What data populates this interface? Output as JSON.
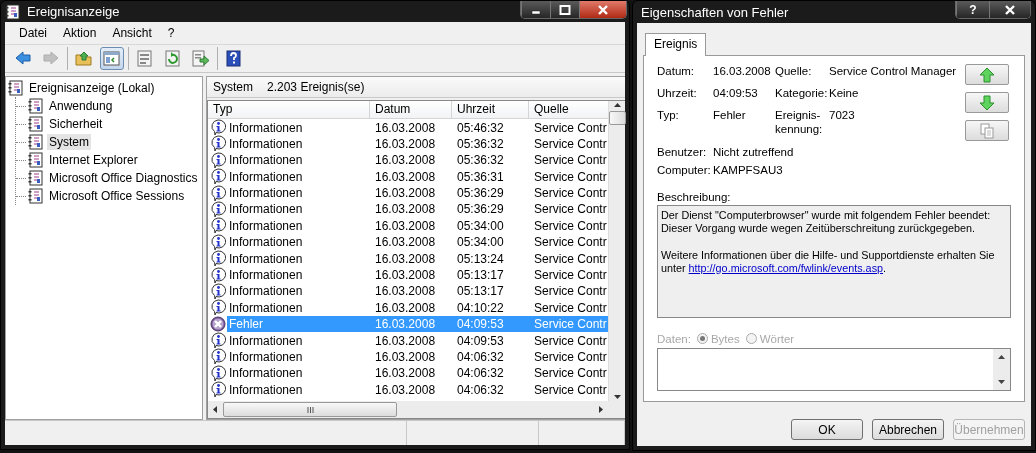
{
  "main_window": {
    "title": "Ereignisanzeige",
    "menu": [
      "Datei",
      "Aktion",
      "Ansicht",
      "?"
    ],
    "toolbar": [
      [
        {
          "kind": "back",
          "disabled": false,
          "pressed": false
        },
        {
          "kind": "forward",
          "disabled": true,
          "pressed": false
        }
      ],
      [
        {
          "kind": "up",
          "disabled": false,
          "pressed": false
        },
        {
          "kind": "tree",
          "disabled": false,
          "pressed": true
        }
      ],
      [
        {
          "kind": "properties",
          "disabled": false,
          "pressed": false
        },
        {
          "kind": "refresh",
          "disabled": false,
          "pressed": false
        },
        {
          "kind": "export",
          "disabled": false,
          "pressed": false
        }
      ],
      [
        {
          "kind": "help",
          "disabled": false,
          "pressed": false
        }
      ]
    ],
    "tree": {
      "label": "Ereignisanzeige (Lokal)",
      "children": [
        {
          "label": "Anwendung",
          "selected": false
        },
        {
          "label": "Sicherheit",
          "selected": false
        },
        {
          "label": "System",
          "selected": true
        },
        {
          "label": "Internet Explorer",
          "selected": false
        },
        {
          "label": "Microsoft Office Diagnostics",
          "selected": false
        },
        {
          "label": "Microsoft Office Sessions",
          "selected": false
        }
      ]
    },
    "pane": {
      "log": "System",
      "count": "2.203 Ereignis(se)"
    },
    "table": {
      "columns": [
        "Typ",
        "Datum",
        "Uhrzeit",
        "Quelle"
      ],
      "rows": [
        {
          "kind": "info",
          "type": "Informationen",
          "date": "16.03.2008",
          "time": "05:46:32",
          "source": "Service Contr",
          "selected": false
        },
        {
          "kind": "info",
          "type": "Informationen",
          "date": "16.03.2008",
          "time": "05:36:32",
          "source": "Service Contr",
          "selected": false
        },
        {
          "kind": "info",
          "type": "Informationen",
          "date": "16.03.2008",
          "time": "05:36:32",
          "source": "Service Contr",
          "selected": false
        },
        {
          "kind": "info",
          "type": "Informationen",
          "date": "16.03.2008",
          "time": "05:36:31",
          "source": "Service Contr",
          "selected": false
        },
        {
          "kind": "info",
          "type": "Informationen",
          "date": "16.03.2008",
          "time": "05:36:29",
          "source": "Service Contr",
          "selected": false
        },
        {
          "kind": "info",
          "type": "Informationen",
          "date": "16.03.2008",
          "time": "05:36:29",
          "source": "Service Contr",
          "selected": false
        },
        {
          "kind": "info",
          "type": "Informationen",
          "date": "16.03.2008",
          "time": "05:34:00",
          "source": "Service Contr",
          "selected": false
        },
        {
          "kind": "info",
          "type": "Informationen",
          "date": "16.03.2008",
          "time": "05:34:00",
          "source": "Service Contr",
          "selected": false
        },
        {
          "kind": "info",
          "type": "Informationen",
          "date": "16.03.2008",
          "time": "05:13:24",
          "source": "Service Contr",
          "selected": false
        },
        {
          "kind": "info",
          "type": "Informationen",
          "date": "16.03.2008",
          "time": "05:13:17",
          "source": "Service Contr",
          "selected": false
        },
        {
          "kind": "info",
          "type": "Informationen",
          "date": "16.03.2008",
          "time": "05:13:17",
          "source": "Service Contr",
          "selected": false
        },
        {
          "kind": "info",
          "type": "Informationen",
          "date": "16.03.2008",
          "time": "04:10:22",
          "source": "Service Contr",
          "selected": false
        },
        {
          "kind": "error",
          "type": "Fehler",
          "date": "16.03.2008",
          "time": "04:09:53",
          "source": "Service Contr",
          "selected": true
        },
        {
          "kind": "info",
          "type": "Informationen",
          "date": "16.03.2008",
          "time": "04:09:53",
          "source": "Service Contr",
          "selected": false
        },
        {
          "kind": "info",
          "type": "Informationen",
          "date": "16.03.2008",
          "time": "04:06:32",
          "source": "Service Contr",
          "selected": false
        },
        {
          "kind": "info",
          "type": "Informationen",
          "date": "16.03.2008",
          "time": "04:06:32",
          "source": "Service Contr",
          "selected": false
        },
        {
          "kind": "info",
          "type": "Informationen",
          "date": "16.03.2008",
          "time": "04:06:32",
          "source": "Service Contr",
          "selected": false
        }
      ]
    }
  },
  "dialog": {
    "title": "Eigenschaften von Fehler",
    "help": "?",
    "tabs": [
      {
        "label": "Ereignis",
        "selected": true
      }
    ],
    "summary": [
      [
        {
          "label": "Datum:",
          "value": "16.03.2008"
        },
        {
          "label": "Quelle:",
          "value": "Service Control Manager"
        }
      ],
      [
        {
          "label": "Uhrzeit:",
          "value": "04:09:53"
        },
        {
          "label": "Kategorie:",
          "value": "Keine"
        }
      ],
      [
        {
          "label": "Typ:",
          "value": "Fehler"
        },
        {
          "label": "Ereignis-kennung:",
          "value": "7023"
        }
      ]
    ],
    "nav": [
      {
        "kind": "up"
      },
      {
        "kind": "down"
      },
      {
        "kind": "copy"
      }
    ],
    "details": [
      {
        "label": "Benutzer:",
        "value": "Nicht zutreffend"
      },
      {
        "label": "Computer:",
        "value": "KAMPFSAU3"
      }
    ],
    "description": {
      "label": "Beschreibung:",
      "paragraphs": [
        {
          "lines": [
            "Der Dienst \"Computerbrowser\" wurde mit folgendem Fehler beendet:",
            "Dieser Vorgang wurde wegen Zeitüberschreitung zurückgegeben."
          ]
        },
        {
          "text": "Weitere Informationen über die Hilfe- und Supportdienste erhalten Sie unter ",
          "link": "http://go.microsoft.com/fwlink/events.asp",
          "after": "."
        }
      ]
    },
    "data": {
      "label": "Daten:",
      "disabled": true,
      "options": [
        {
          "label": "Bytes",
          "selected": true
        },
        {
          "label": "Wörter",
          "selected": false
        }
      ]
    },
    "buttons": [
      {
        "label": "OK",
        "disabled": false
      },
      {
        "label": "Abbrechen",
        "disabled": false
      },
      {
        "label": "Übernehmen",
        "disabled": true
      }
    ]
  }
}
